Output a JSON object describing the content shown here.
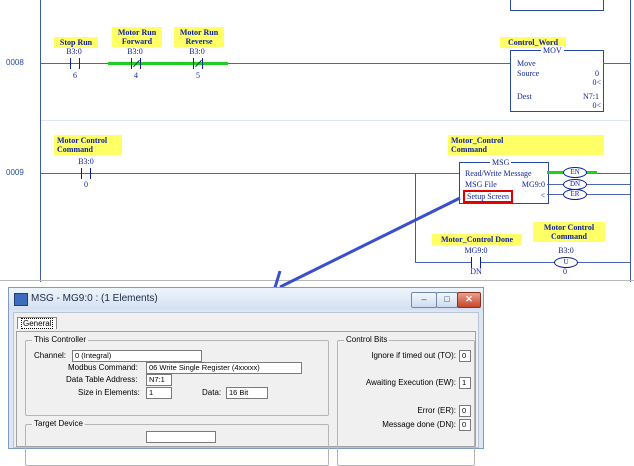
{
  "rungs": [
    {
      "number": "0008",
      "contacts": [
        {
          "label": "Stop Run",
          "address": "B3:0",
          "bit": "6"
        },
        {
          "label": "Motor Run\nForward",
          "address": "B3:0",
          "bit": "4"
        },
        {
          "label": "Motor Run\nReverse",
          "address": "B3:0",
          "bit": "5"
        }
      ],
      "output_label": "Control_Word",
      "instruction": {
        "name": "MOV",
        "title": "Move",
        "source_label": "Source",
        "source_value": "0",
        "source_sub": "0<",
        "dest_label": "Dest",
        "dest_value": "N7:1",
        "dest_sub": "0<"
      }
    },
    {
      "number": "0009",
      "contact": {
        "label": "Motor Control\nCommand",
        "address": "B3:0",
        "bit": "0"
      },
      "msg_label": "Motor_Control\nCommand",
      "msg": {
        "name": "MSG",
        "line1": "Read/Write Message",
        "file_label": "MSG File",
        "file_value": "MG9:0",
        "setup": "Setup Screen",
        "arrow": "<"
      },
      "coils": [
        "EN",
        "DN",
        "ER"
      ],
      "branch_contact": {
        "label": "Motor_Control Done",
        "address": "MG9:0",
        "bit": "DN"
      },
      "branch_coil": {
        "label": "Motor Control\nCommand",
        "address": "B3:0",
        "symbol": "U",
        "bit": "0"
      }
    }
  ],
  "dialog": {
    "title": "MSG - MG9:0 : (1 Elements)",
    "tab": "General",
    "this_controller": {
      "legend": "This Controller",
      "channel_label": "Channel:",
      "channel_value": "0 (Integral)",
      "modbus_label": "Modbus Command:",
      "modbus_value": "06 Write Single Register (4xxxxx)",
      "dta_label": "Data Table Address:",
      "dta_value": "N7:1",
      "size_label": "Size in Elements:",
      "size_value": "1",
      "data_label": "Data:",
      "data_value": "16 Bit"
    },
    "target_device": {
      "legend": "Target Device"
    },
    "control_bits": {
      "legend": "Control Bits",
      "items": [
        {
          "label": "Ignore if timed out (TO):",
          "value": "0"
        },
        {
          "label": "Awaiting Execution (EW):",
          "value": "1"
        },
        {
          "label": "Error (ER):",
          "value": "0"
        },
        {
          "label": "Message done (DN):",
          "value": "0"
        }
      ]
    },
    "buttons": {
      "minimize": "–",
      "maximize": "□",
      "close": "✕"
    }
  }
}
